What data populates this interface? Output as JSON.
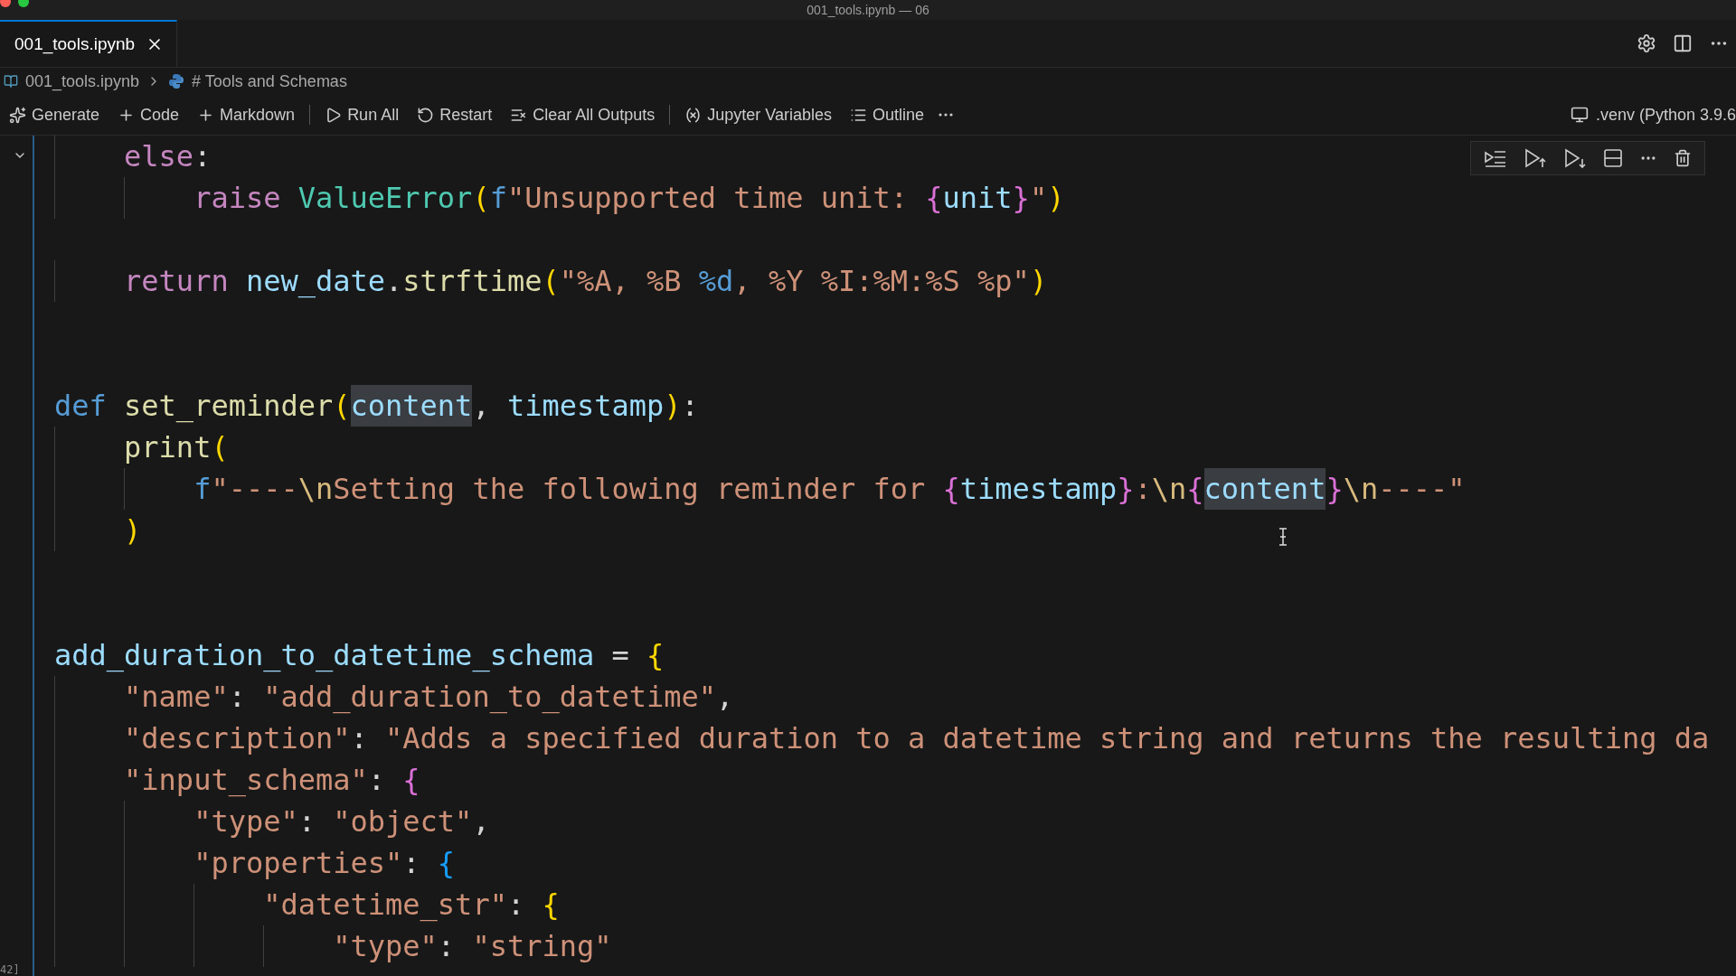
{
  "window": {
    "title": "001_tools.ipynb — 06"
  },
  "tabs": [
    {
      "label": "001_tools.ipynb",
      "selected": true
    }
  ],
  "breadcrumb": [
    "001_tools.ipynb",
    "# Tools and Schemas"
  ],
  "toolbar": {
    "groups": [
      [
        "Generate",
        "Code",
        "Markdown"
      ],
      [
        "Run All",
        "Restart",
        "Clear All Outputs"
      ],
      [
        "Jupyter Variables",
        "Outline"
      ]
    ],
    "kernel": ".venv (Python 3.9.6"
  },
  "cell": {
    "execution_count": "42]",
    "lines": [
      {
        "kind": "code",
        "tokens": [
          {
            "kind": "kw",
            "text": "    else"
          },
          {
            "kind": "plain",
            "text": ":"
          }
        ]
      },
      {
        "kind": "code",
        "tokens": [
          {
            "kind": "kw",
            "text": "        raise "
          },
          {
            "kind": "cls",
            "text": "ValueError"
          },
          {
            "kind": "b1",
            "text": "("
          },
          {
            "kind": "def",
            "text": "f"
          },
          {
            "kind": "str",
            "text": "\"Unsupported time unit: "
          },
          {
            "kind": "b2",
            "text": "{"
          },
          {
            "kind": "var",
            "text": "unit"
          },
          {
            "kind": "b2",
            "text": "}"
          },
          {
            "kind": "str",
            "text": "\""
          },
          {
            "kind": "b1",
            "text": ")"
          }
        ]
      },
      {
        "kind": "blank"
      },
      {
        "kind": "code",
        "tokens": [
          {
            "kind": "kw",
            "text": "    return "
          },
          {
            "kind": "var",
            "text": "new_date"
          },
          {
            "kind": "plain",
            "text": "."
          },
          {
            "kind": "fn",
            "text": "strftime"
          },
          {
            "kind": "b1",
            "text": "("
          },
          {
            "kind": "str",
            "text": "\"%A, %B "
          },
          {
            "kind": "def",
            "text": "%d"
          },
          {
            "kind": "str",
            "text": ", %Y %I:%M:%S %p\""
          },
          {
            "kind": "b1",
            "text": ")"
          }
        ]
      },
      {
        "kind": "blank"
      },
      {
        "kind": "blank"
      },
      {
        "kind": "code",
        "tokens": [
          {
            "kind": "def",
            "text": "def "
          },
          {
            "kind": "fn",
            "text": "set_reminder"
          },
          {
            "kind": "b1",
            "text": "("
          },
          {
            "kind": "match",
            "text": "content"
          },
          {
            "kind": "plain",
            "text": ", "
          },
          {
            "kind": "var",
            "text": "timestamp"
          },
          {
            "kind": "b1",
            "text": ")"
          },
          {
            "kind": "plain",
            "text": ":"
          }
        ]
      },
      {
        "kind": "code",
        "tokens": [
          {
            "kind": "fn",
            "text": "    print"
          },
          {
            "kind": "b1",
            "text": "("
          }
        ]
      },
      {
        "kind": "code",
        "tokens": [
          {
            "kind": "def",
            "text": "        f"
          },
          {
            "kind": "str",
            "text": "\"----"
          },
          {
            "kind": "esc",
            "text": "\\n"
          },
          {
            "kind": "str",
            "text": "Setting the following reminder for "
          },
          {
            "kind": "b2",
            "text": "{"
          },
          {
            "kind": "var",
            "text": "timestamp"
          },
          {
            "kind": "b2",
            "text": "}"
          },
          {
            "kind": "str",
            "text": ":"
          },
          {
            "kind": "esc",
            "text": "\\n"
          },
          {
            "kind": "b2",
            "text": "{"
          },
          {
            "kind": "match",
            "text": "content"
          },
          {
            "kind": "b2",
            "text": "}"
          },
          {
            "kind": "esc",
            "text": "\\n"
          },
          {
            "kind": "str",
            "text": "----\""
          }
        ]
      },
      {
        "kind": "code",
        "tokens": [
          {
            "kind": "b1",
            "text": "    )"
          }
        ]
      },
      {
        "kind": "blank"
      },
      {
        "kind": "blank"
      },
      {
        "kind": "code",
        "tokens": [
          {
            "kind": "var",
            "text": "add_duration_to_datetime_schema"
          },
          {
            "kind": "plain",
            "text": " = "
          },
          {
            "kind": "b1",
            "text": "{"
          }
        ]
      },
      {
        "kind": "code",
        "tokens": [
          {
            "kind": "str",
            "text": "    \"name\""
          },
          {
            "kind": "plain",
            "text": ": "
          },
          {
            "kind": "str",
            "text": "\"add_duration_to_datetime\""
          },
          {
            "kind": "plain",
            "text": ","
          }
        ]
      },
      {
        "kind": "code",
        "tokens": [
          {
            "kind": "str",
            "text": "    \"description\""
          },
          {
            "kind": "plain",
            "text": ": "
          },
          {
            "kind": "str",
            "text": "\"Adds a specified duration to a datetime string and returns the resulting da"
          }
        ]
      },
      {
        "kind": "code",
        "tokens": [
          {
            "kind": "str",
            "text": "    \"input_schema\""
          },
          {
            "kind": "plain",
            "text": ": "
          },
          {
            "kind": "b2",
            "text": "{"
          }
        ]
      },
      {
        "kind": "code",
        "tokens": [
          {
            "kind": "str",
            "text": "        \"type\""
          },
          {
            "kind": "plain",
            "text": ": "
          },
          {
            "kind": "str",
            "text": "\"object\""
          },
          {
            "kind": "plain",
            "text": ","
          }
        ]
      },
      {
        "kind": "code",
        "tokens": [
          {
            "kind": "str",
            "text": "        \"properties\""
          },
          {
            "kind": "plain",
            "text": ": "
          },
          {
            "kind": "b3",
            "text": "{"
          }
        ]
      },
      {
        "kind": "code",
        "tokens": [
          {
            "kind": "str",
            "text": "            \"datetime_str\""
          },
          {
            "kind": "plain",
            "text": ": "
          },
          {
            "kind": "b1",
            "text": "{"
          }
        ]
      },
      {
        "kind": "code",
        "tokens": [
          {
            "kind": "str",
            "text": "                \"type\""
          },
          {
            "kind": "plain",
            "text": ": "
          },
          {
            "kind": "str",
            "text": "\"string\""
          }
        ]
      }
    ]
  }
}
